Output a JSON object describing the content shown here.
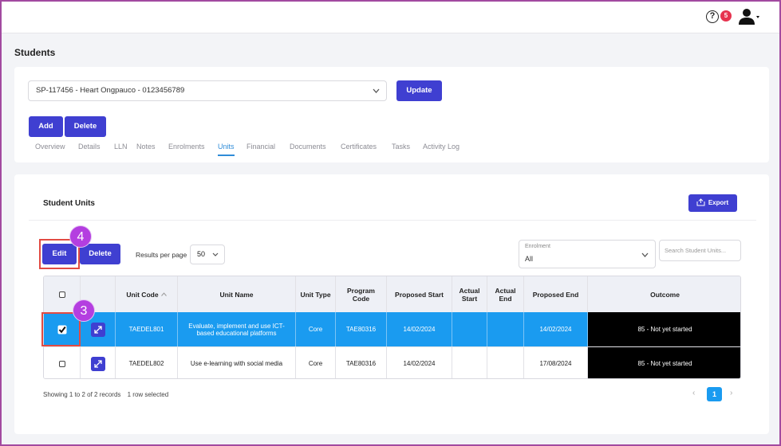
{
  "header": {
    "help_icon_glyph": "?",
    "notification_count": "5"
  },
  "page": {
    "title": "Students"
  },
  "student_selector": {
    "value": "SP-117456 - Heart Ongpauco - 0123456789",
    "update_label": "Update"
  },
  "actions": {
    "add_label": "Add",
    "delete_label": "Delete"
  },
  "tabs": [
    {
      "label": "Overview"
    },
    {
      "label": "Details"
    },
    {
      "label": "LLN"
    },
    {
      "label": "Notes"
    },
    {
      "label": "Enrolments"
    },
    {
      "label": "Units",
      "active": true
    },
    {
      "label": "Financial"
    },
    {
      "label": "Documents"
    },
    {
      "label": "Certificates"
    },
    {
      "label": "Tasks"
    },
    {
      "label": "Activity Log"
    }
  ],
  "units_section": {
    "title": "Student Units",
    "export_label": "Export",
    "edit_label": "Edit",
    "delete_label": "Delete",
    "results_per_page_label": "Results per page",
    "results_per_page_value": "50",
    "enrolment_label": "Enrolment",
    "enrolment_value": "All",
    "search_placeholder": "Search Student Units..."
  },
  "table": {
    "columns": [
      "Unit Code",
      "Unit Name",
      "Unit Type",
      "Program Code",
      "Proposed Start",
      "Actual Start",
      "Actual End",
      "Proposed End",
      "Outcome"
    ],
    "rows": [
      {
        "selected": true,
        "unit_code": "TAEDEL801",
        "unit_name": "Evaluate, implement and use ICT-based educational platforms",
        "unit_type": "Core",
        "program_code": "TAE80316",
        "proposed_start": "14/02/2024",
        "actual_start": "",
        "actual_end": "",
        "proposed_end": "14/02/2024",
        "outcome": "85 - Not yet started"
      },
      {
        "selected": false,
        "unit_code": "TAEDEL802",
        "unit_name": "Use e-learning with social media",
        "unit_type": "Core",
        "program_code": "TAE80316",
        "proposed_start": "14/02/2024",
        "actual_start": "",
        "actual_end": "",
        "proposed_end": "17/08/2024",
        "outcome": "85 - Not yet started"
      }
    ]
  },
  "footer": {
    "records_text": "Showing 1 to 2 of 2 records",
    "selection_text": "1 row selected",
    "prev_glyph": "‹",
    "current_page": "1",
    "next_glyph": "›"
  },
  "annotations": {
    "step_edit": "4",
    "step_checkbox": "3",
    "highlight_color": "#e24b43",
    "badge_color": "#b43ee0"
  },
  "colors": {
    "primary": "#3f3fd1",
    "selected_row": "#1a9bf0",
    "active_tab": "#2f8cd8",
    "notification": "#e6334f"
  }
}
